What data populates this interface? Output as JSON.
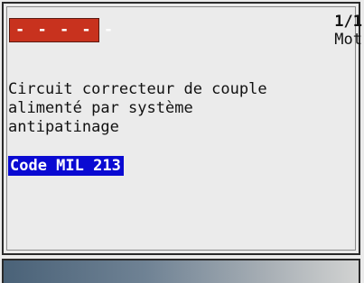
{
  "header": {
    "dtc_code": "- - - - -",
    "counter": "1/1",
    "module": "Mot"
  },
  "description": {
    "lines": [
      "Circuit correcteur de couple",
      "alimenté par système",
      "antipatinage"
    ]
  },
  "mil": {
    "label": "Code MIL 213"
  },
  "colors": {
    "dtc_background": "#c8321e",
    "mil_highlight": "#0a0ad2",
    "screen_background": "#ebebeb"
  }
}
